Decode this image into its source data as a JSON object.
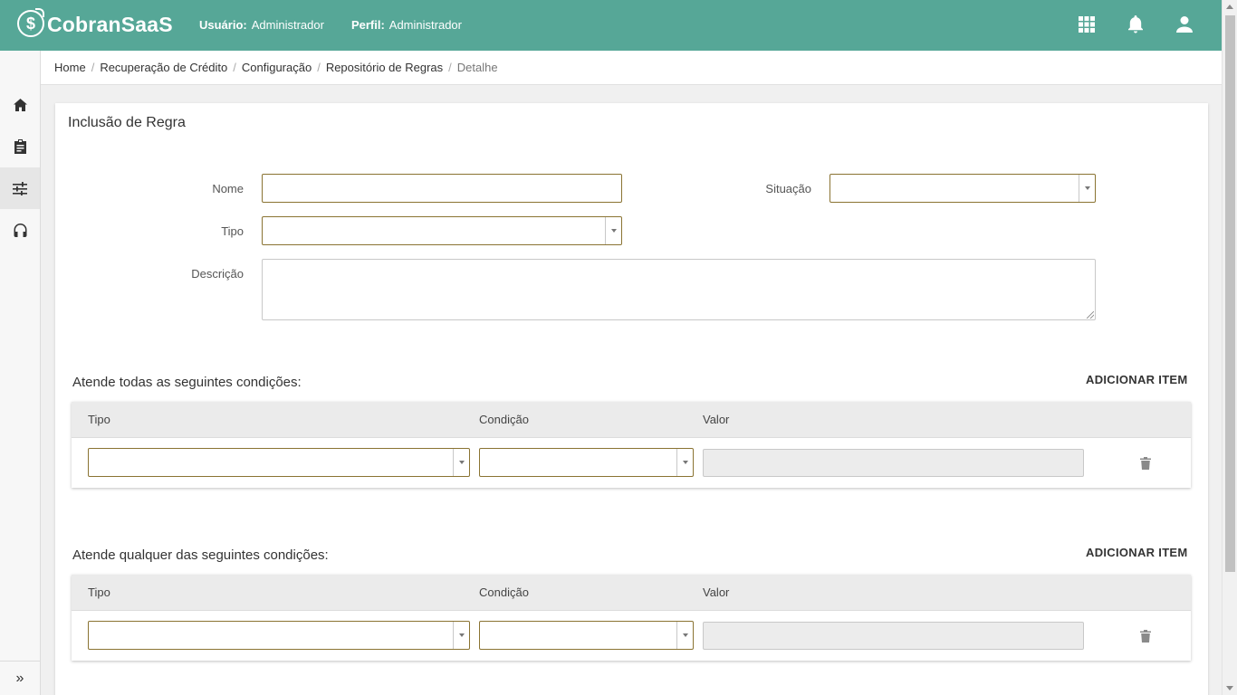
{
  "header": {
    "brand": "CobranSaaS",
    "logo_glyph": "$",
    "user_label": "Usuário:",
    "user_value": "Administrador",
    "profile_label": "Perfil:",
    "profile_value": "Administrador",
    "icons": [
      "apps-grid-icon",
      "bell-icon",
      "user-icon"
    ],
    "accent": "#56a797"
  },
  "sidebar": {
    "items": [
      "home-icon",
      "clipboard-icon",
      "sliders-icon",
      "headset-icon"
    ],
    "active_index": 2,
    "expand_glyph": "»"
  },
  "breadcrumb": {
    "items": [
      "Home",
      "Recuperação de Crédito",
      "Configuração",
      "Repositório de Regras",
      "Detalhe"
    ],
    "separator": "/"
  },
  "form": {
    "title": "Inclusão de Regra",
    "nome_label": "Nome",
    "nome_value": "",
    "situacao_label": "Situação",
    "situacao_value": "",
    "tipo_label": "Tipo",
    "tipo_value": "",
    "descricao_label": "Descrição",
    "descricao_value": ""
  },
  "sections": [
    {
      "title": "Atende todas as seguintes condições:",
      "add_label": "ADICIONAR ITEM",
      "columns": [
        "Tipo",
        "Condição",
        "Valor"
      ],
      "rows": [
        {
          "tipo": "",
          "condicao": "",
          "valor": ""
        }
      ]
    },
    {
      "title": "Atende qualquer das seguintes condições:",
      "add_label": "ADICIONAR ITEM",
      "columns": [
        "Tipo",
        "Condição",
        "Valor"
      ],
      "rows": [
        {
          "tipo": "",
          "condicao": "",
          "valor": ""
        }
      ]
    }
  ]
}
